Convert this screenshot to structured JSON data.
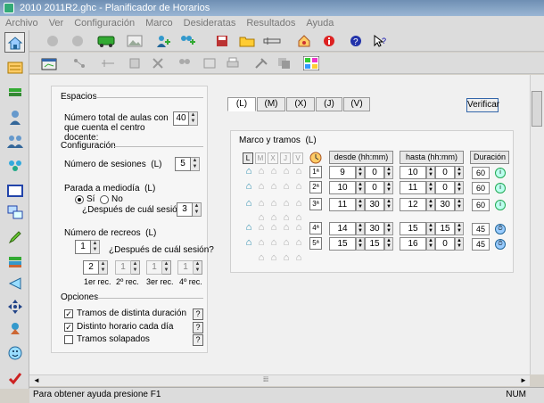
{
  "window": {
    "title": "2010 2011R2.ghc - Planificador de Horarios"
  },
  "menu": [
    "Archivo",
    "Ver",
    "Configuración",
    "Marco",
    "Desideratas",
    "Resultados",
    "Ayuda"
  ],
  "toolbar_icons": [
    "home-icon",
    "back-icon",
    "forward-icon",
    "bus-icon",
    "image-icon",
    "add-user-icon",
    "add-group-icon",
    "save-icon",
    "open-folder-icon",
    "tool-icon",
    "settings-home-icon",
    "info-icon",
    "help-icon",
    "context-help-icon",
    "schedule-icon",
    "network-icon",
    "cut-icon",
    "users-icon",
    "export-icon",
    "print-icon",
    "color-grid-icon"
  ],
  "espacios": {
    "title": "Espacios",
    "label": "Número total de aulas con que cuenta el centro docente:",
    "value": "40"
  },
  "configuracion": {
    "title": "Configuración",
    "sesiones_label": "Número de sesiones",
    "sesiones_day": "(L)",
    "sesiones_value": "5",
    "parada_label": "Parada a mediodía",
    "parada_day": "(L)",
    "si_label": "Sí",
    "no_label": "No",
    "despues_label": "¿Después de cuál sesión?",
    "despues_value": "3",
    "recreos_label": "Número de recreos",
    "recreos_day": "(L)",
    "recreos_value": "1",
    "despues2_label": "¿Después de cuál sesión?",
    "recreos_sessions": [
      {
        "value": "2",
        "label": "1er rec."
      },
      {
        "value": "1",
        "label": "2º rec."
      },
      {
        "value": "1",
        "label": "3er rec."
      },
      {
        "value": "1",
        "label": "4º rec."
      }
    ]
  },
  "opciones": {
    "title": "Opciones",
    "items": [
      {
        "label": "Tramos de distinta duración",
        "checked": true
      },
      {
        "label": "Distinto horario cada día",
        "checked": true
      },
      {
        "label": "Tramos solapados",
        "checked": false
      }
    ]
  },
  "tabs": [
    "(L)",
    "(M)",
    "(X)",
    "(J)",
    "(V)"
  ],
  "verificar": "Verificar",
  "marco": {
    "title": "Marco y tramos",
    "day": "(L)",
    "days": [
      "L",
      "M",
      "X",
      "J",
      "V"
    ],
    "desde": "desde (hh:mm)",
    "hasta": "hasta (hh:mm)",
    "duracion": "Duración",
    "rows": [
      {
        "session": "1ª",
        "dh": "9",
        "dm": "0",
        "hh": "10",
        "hm": "0",
        "dur": "60"
      },
      {
        "session": "2ª",
        "dh": "10",
        "dm": "0",
        "hh": "11",
        "hm": "0",
        "dur": "60"
      },
      {
        "session": "3ª",
        "dh": "11",
        "dm": "30",
        "hh": "12",
        "hm": "30",
        "dur": "60"
      },
      {
        "session": "4ª",
        "dh": "14",
        "dm": "30",
        "hh": "15",
        "hm": "15",
        "dur": "45"
      },
      {
        "session": "5ª",
        "dh": "15",
        "dm": "15",
        "hh": "16",
        "hm": "0",
        "dur": "45"
      }
    ]
  },
  "status": {
    "help": "Para obtener ayuda presione F1",
    "num": "NUM"
  }
}
